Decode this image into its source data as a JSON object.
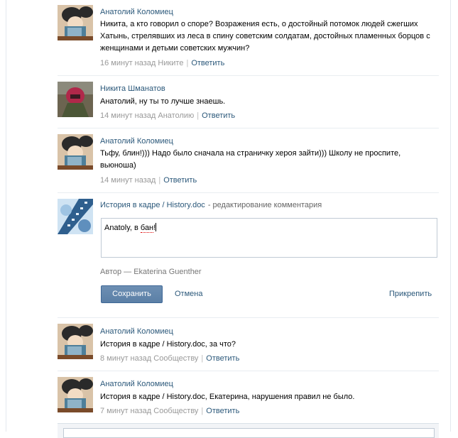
{
  "comments_top": [
    {
      "author": "Анатолий Коломиец",
      "text": "Никита, а кто говорил о споре? Возражения есть, о достойный потомок людей сжегших Хатынь, стрелявших из леса в спину советским солдатам, достойных пламенных борцов с женщинами и детьми советских мужчин?",
      "time": "16 минут назад Никите",
      "reply": "Ответить"
    },
    {
      "author": "Никита Шманатов",
      "text": "Анатолий, ну ты то лучше знаешь.",
      "time": "14 минут назад Анатолию",
      "reply": "Ответить"
    },
    {
      "author": "Анатолий Коломиец",
      "text": "Тьфу, блин!))) Надо было сначала на страничку хероя зайти))) Школу не проспите, вьюноша)",
      "time": "14 минут назад",
      "reply": "Ответить"
    }
  ],
  "editor": {
    "group_name": "История в кадре / History.doc",
    "status": "- редактирование комментария",
    "text_before": "Anatoly, в ",
    "text_marked": "бан",
    "text_after": "!",
    "author_label": "Автор — Ekaterina Guenther",
    "save_label": "Сохранить",
    "cancel_label": "Отмена",
    "attach_label": "Прикрепить"
  },
  "comments_bottom": [
    {
      "author": "Анатолий Коломиец",
      "text": "История в кадре / History.doc, за что?",
      "time": "8 минут назад Сообществу",
      "reply": "Ответить"
    },
    {
      "author": "Анатолий Коломиец",
      "text": "История в кадре / History.doc, Екатерина, нарушения правил не было.",
      "time": "7 минут назад Сообществу",
      "reply": "Ответить"
    }
  ]
}
